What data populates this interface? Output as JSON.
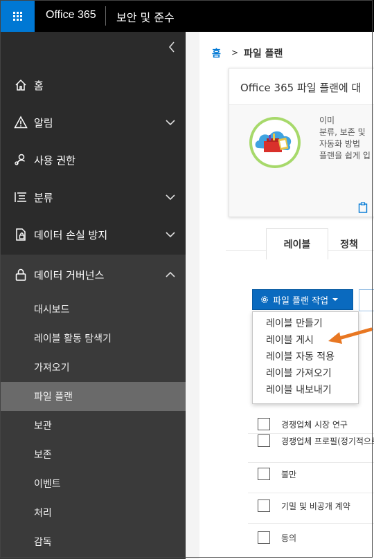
{
  "topbar": {
    "brand": "Office 365",
    "title": "보안 및 준수"
  },
  "sidebar": {
    "items": [
      {
        "label": "홈",
        "icon": "home-icon"
      },
      {
        "label": "알림",
        "icon": "alert-icon"
      },
      {
        "label": "사용 권한",
        "icon": "permissions-icon"
      },
      {
        "label": "분류",
        "icon": "classification-icon"
      },
      {
        "label": "데이터 손실 방지",
        "icon": "dlp-icon"
      },
      {
        "label": "데이터 거버넌스",
        "icon": "lock-icon"
      }
    ],
    "sub_items": [
      "대시보드",
      "레이블 활동 탐색기",
      "가져오기",
      "파일 플랜",
      "보관",
      "보존",
      "이벤트",
      "처리",
      "감독"
    ],
    "active_sub": "파일 플랜"
  },
  "breadcrumb": {
    "home": "홈",
    "separator": ">",
    "current": "파일 플랜"
  },
  "card": {
    "title": "Office 365 파일 플랜에 대",
    "lines": [
      "이미",
      "분류, 보존 및",
      "자동화 방법",
      "플랜을 쉽게 입"
    ]
  },
  "tabs": {
    "labels": "레이블",
    "policy": "정책"
  },
  "action": {
    "label": "파일 플랜 작업"
  },
  "menu": [
    "레이블 만들기",
    "레이블 게시",
    "레이블 자동 적용",
    "레이블 가져오기",
    "레이블 내보내기"
  ],
  "rows": [
    "경쟁업체 시장 연구",
    "경쟁업체 프로필(정기적으로",
    "불만",
    "기밀 및 비공개 계약",
    "동의"
  ],
  "colors": {
    "accent": "#0078d4",
    "arrow": "#e87722",
    "sidebar": "#2b2b2b"
  }
}
